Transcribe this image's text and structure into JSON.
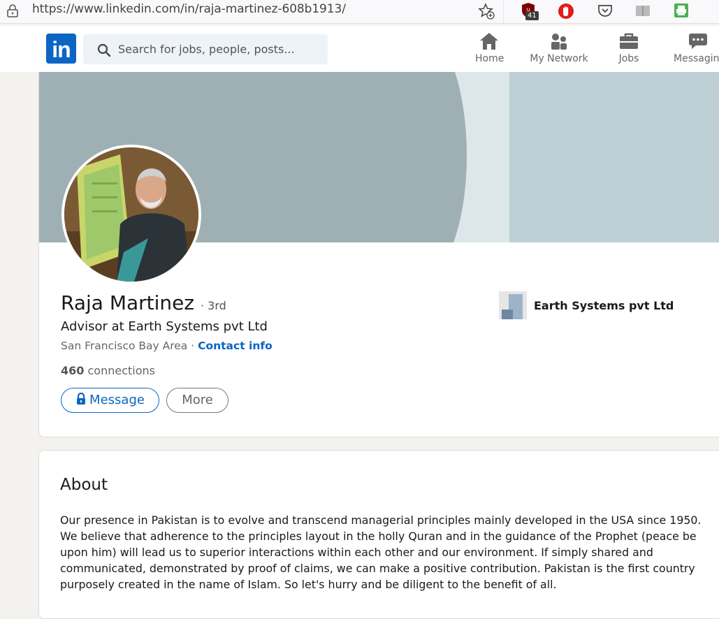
{
  "browser": {
    "url": "https://www.linkedin.com/in/raja-martinez-608b1913/",
    "extension_badge": "41"
  },
  "nav": {
    "logo_text": "in",
    "search_placeholder": "Search for jobs, people, posts...",
    "items": [
      {
        "label": "Home",
        "icon": "home-icon"
      },
      {
        "label": "My Network",
        "icon": "network-icon"
      },
      {
        "label": "Jobs",
        "icon": "briefcase-icon"
      },
      {
        "label": "Messaging",
        "icon": "chat-icon"
      }
    ]
  },
  "profile": {
    "name": "Raja Martinez",
    "degree": "· 3rd",
    "headline": "Advisor at Earth Systems pvt Ltd",
    "location": "San Francisco Bay Area",
    "separator": " · ",
    "contact_label": "Contact info",
    "connections_count": "460",
    "connections_label": " connections",
    "message_label": "Message",
    "more_label": "More",
    "company": "Earth Systems pvt Ltd"
  },
  "about": {
    "title": "About",
    "text": "Our presence in Pakistan is to evolve and transcend managerial principles mainly developed in the USA since 1950. We believe that adherence to the principles layout in the holly Quran and in the guidance of the Prophet (peace be upon him) will lead us to superior interactions within each other and our environment. If simply shared and communicated, demonstrated by proof of claims, we can make a positive contribution. Pakistan is the first country purposely created in the name of Islam. So let's hurry and be diligent to the benefit of all."
  },
  "colors": {
    "brand": "#0a66c2",
    "page_bg": "#f3f2ef",
    "banner_dark": "#9fb0b4",
    "banner_light": "#bed0d5"
  }
}
